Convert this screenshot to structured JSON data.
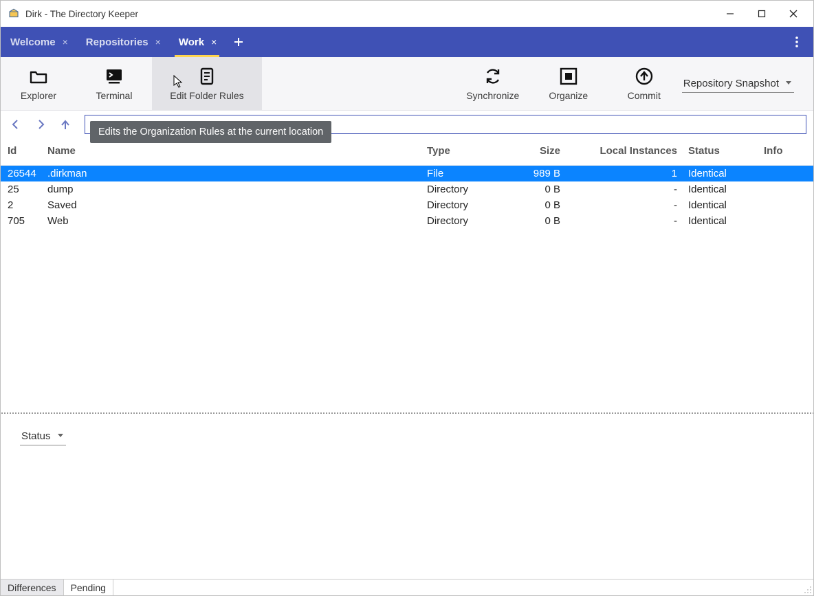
{
  "window": {
    "title": "Dirk - The Directory Keeper"
  },
  "tabs": {
    "items": [
      {
        "label": "Welcome",
        "closable": true,
        "active": false
      },
      {
        "label": "Repositories",
        "closable": true,
        "active": false
      },
      {
        "label": "Work",
        "closable": true,
        "active": true
      }
    ]
  },
  "toolbar": {
    "explorer": "Explorer",
    "terminal": "Terminal",
    "edit_folder_rules": "Edit Folder Rules",
    "synchronize": "Synchronize",
    "organize": "Organize",
    "commit": "Commit",
    "snapshot_label": "Repository Snapshot"
  },
  "tooltip": {
    "edit_folder_rules": "Edits the Organization Rules at the current location"
  },
  "table": {
    "headers": {
      "id": "Id",
      "name": "Name",
      "type": "Type",
      "size": "Size",
      "local": "Local Instances",
      "status": "Status",
      "info": "Info"
    },
    "rows": [
      {
        "id": "26544",
        "name": ".dirkman",
        "type": "File",
        "size": "989 B",
        "local": "1",
        "status": "Identical",
        "info": "",
        "selected": true
      },
      {
        "id": "25",
        "name": "dump",
        "type": "Directory",
        "size": "0 B",
        "local": "-",
        "status": "Identical",
        "info": "",
        "selected": false
      },
      {
        "id": "2",
        "name": "Saved",
        "type": "Directory",
        "size": "0 B",
        "local": "-",
        "status": "Identical",
        "info": "",
        "selected": false
      },
      {
        "id": "705",
        "name": "Web",
        "type": "Directory",
        "size": "0 B",
        "local": "-",
        "status": "Identical",
        "info": "",
        "selected": false
      }
    ]
  },
  "lower": {
    "status_label": "Status"
  },
  "bottom_tabs": {
    "differences": "Differences",
    "pending": "Pending"
  }
}
